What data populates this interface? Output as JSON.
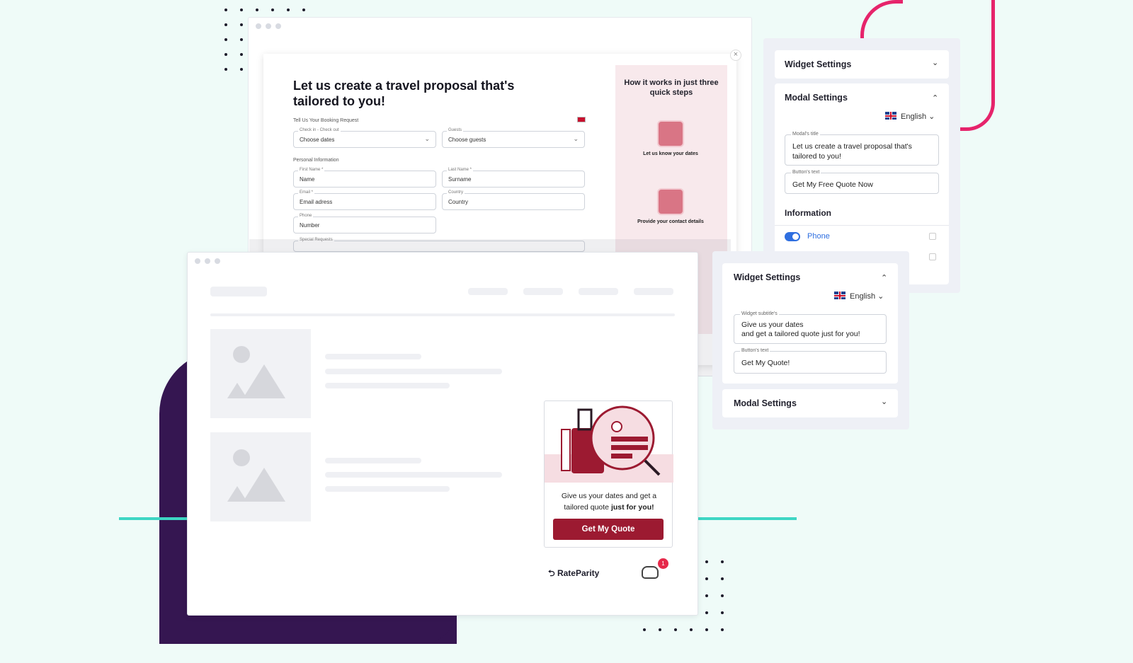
{
  "modal": {
    "title": "Let us create a travel proposal that's tailored to you!",
    "booking_heading": "Tell Us Your Booking Request",
    "checkin_label": "Check in - Check out",
    "checkin_value": "Choose dates",
    "guests_label": "Guests",
    "guests_value": "Choose guests",
    "personal_heading": "Personal Information",
    "first_name_label": "First Name *",
    "first_name_value": "Name",
    "last_name_label": "Last Name *",
    "last_name_value": "Surname",
    "email_label": "Email *",
    "email_value": "Email adress",
    "country_label": "Country",
    "country_value": "Country",
    "phone_label": "Phone",
    "phone_value": "Number",
    "special_label": "Special Requests",
    "close_glyph": "×"
  },
  "steps": {
    "title": "How it works in just three quick steps",
    "step1": "Let us know your dates",
    "step2": "Provide your contact details"
  },
  "widget_card": {
    "text_pre": "Give us your dates and get a tailored quote ",
    "text_bold": "just for you!",
    "button": "Get My Quote"
  },
  "brand": {
    "name": "RateParity",
    "notification_count": "1"
  },
  "panel_top": {
    "widget_settings": "Widget Settings",
    "modal_settings": "Modal Settings",
    "language": "English",
    "modal_title_label": "Modal's title",
    "modal_title_value": "Let us create a travel proposal that's tailored to you!",
    "button_text_label": "Button's text",
    "button_text_value": "Get My Free Quote Now",
    "information": "Information",
    "phone_label": "Phone"
  },
  "panel_bottom": {
    "widget_settings": "Widget Settings",
    "language": "English",
    "subtitle_label": "Widget subtitle's",
    "subtitle_value": "Give us your dates\nand get a tailored quote just for you!",
    "button_text_label": "Button's text",
    "button_text_value": "Get My Quote!",
    "modal_settings": "Modal Settings"
  },
  "icons": {
    "chevron_down": "⌄",
    "chevron_up": "⌃"
  },
  "colors": {
    "accent": "#9c1a31",
    "purple": "#351651",
    "pink": "#e6246b",
    "teal": "#3ed6c4",
    "toggle": "#2f6fe0"
  }
}
